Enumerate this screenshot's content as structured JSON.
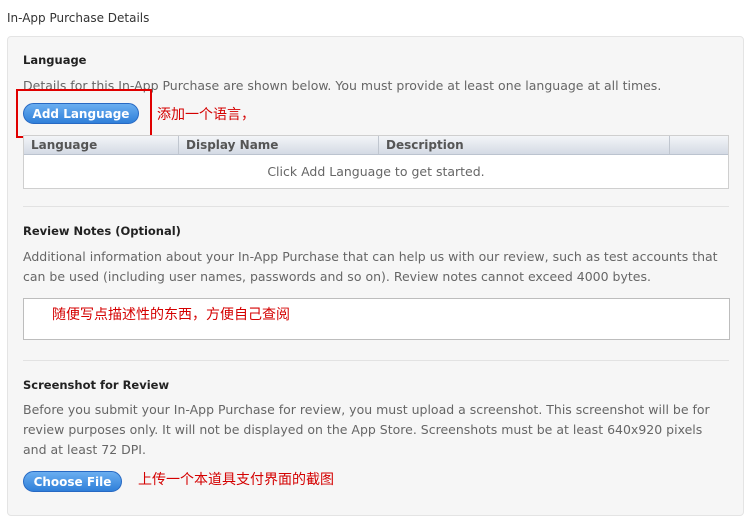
{
  "page_title": "In-App Purchase Details",
  "language": {
    "title": "Language",
    "description": "Details for this In-App Purchase are shown below. You must provide at least one language at all times.",
    "add_button_label": "Add Language",
    "annotation": "添加一个语言，",
    "table": {
      "columns": [
        "Language",
        "Display Name",
        "Description"
      ],
      "empty_message": "Click Add Language to get started."
    }
  },
  "review_notes": {
    "title": "Review Notes (Optional)",
    "description_line1": "Additional information about your In-App Purchase that can help us with our review, such as test accounts that",
    "description_line2": "can be used (including user names, passwords and so on). Review notes cannot exceed 4000 bytes.",
    "value": "随便写点描述性的东西，方便自己查阅"
  },
  "screenshot": {
    "title": "Screenshot for Review",
    "description_line1": "Before you submit your In-App Purchase for review, you must upload a screenshot. This screenshot will be for",
    "description_line2": "review purposes only. It will not be displayed on the App Store. Screenshots must be at least 640x920 pixels",
    "description_line3": "and at least 72 DPI.",
    "choose_button_label": "Choose File",
    "annotation": "上传一个本道具支付界面的截图"
  },
  "colors": {
    "accent_button": "#3a86dc",
    "annotation_red": "#d40000"
  }
}
